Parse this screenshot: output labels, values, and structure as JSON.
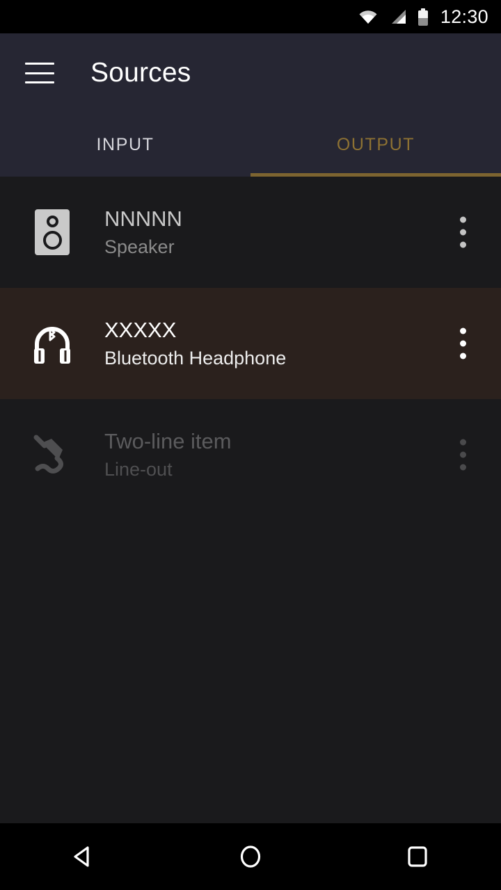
{
  "status_bar": {
    "time": "12:30",
    "icons": [
      "wifi-icon",
      "cellular-signal-icon",
      "battery-icon"
    ]
  },
  "toolbar": {
    "menu_icon": "hamburger-menu-icon",
    "title": "Sources"
  },
  "tabs": {
    "items": [
      {
        "label": "INPUT",
        "active": false
      },
      {
        "label": "OUTPUT",
        "active": true
      }
    ],
    "active_color": "#8d7133",
    "inactive_color": "#d6d6dc",
    "indicator_color": "#7d6430"
  },
  "list": {
    "rows": [
      {
        "title": "NNNNN",
        "subtitle": "Speaker",
        "icon": "speaker-icon",
        "state": "normal",
        "overflow_icon": "more-vertical-icon"
      },
      {
        "title": "XXXXX",
        "subtitle": "Bluetooth Headphone",
        "icon": "bluetooth-headphone-icon",
        "state": "selected",
        "overflow_icon": "more-vertical-icon"
      },
      {
        "title": "Two-line item",
        "subtitle": "Line-out",
        "icon": "audio-jack-icon",
        "state": "disabled",
        "overflow_icon": "more-vertical-icon"
      }
    ]
  },
  "navigation_bar": {
    "back": "back-triangle-icon",
    "home": "home-circle-icon",
    "recents": "recents-square-icon"
  },
  "colors": {
    "toolbar_bg": "#262633",
    "list_bg": "#1a1a1c",
    "selected_row_bg": "#2b211d",
    "accent": "#8d7133"
  }
}
